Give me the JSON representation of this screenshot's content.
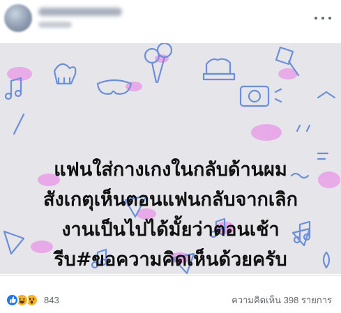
{
  "post": {
    "author_name": "",
    "meta": "",
    "more_icon": "more-horizontal-icon",
    "image": {
      "background_color": "#e5e5ea",
      "lines": [
        "แฟนใส่กางเกงในกลับด้านผม",
        "สังเกตุเห็นตอนแฟนกลับจากเลิก",
        "งานเป็นไปได้มั้ยว่าตอนเช้า",
        "รีบ#ขอความคิดเห็นด้วยครับ"
      ]
    },
    "footer": {
      "reaction_icons": [
        "like-icon",
        "haha-icon",
        "wow-icon"
      ],
      "reaction_count": "843",
      "comments_text": "ความคิดเห็น 398 รายการ"
    },
    "colors": {
      "accent_blue": "#1877f2",
      "reaction_yellow": "#f7b125",
      "meta_gray": "#65676b",
      "doodle_blue": "#6b8fd8",
      "doodle_pink": "#e9a3e8"
    }
  }
}
